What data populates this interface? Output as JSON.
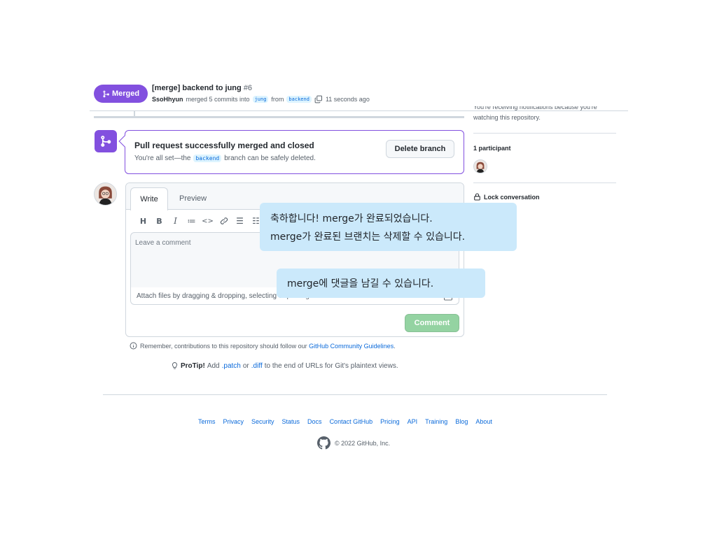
{
  "header": {
    "status_badge": "Merged",
    "pr_title": "[merge] backend to jung",
    "pr_number": "#6",
    "author": "SsoHhyun",
    "merge_text": "merged 5 commits into",
    "base_branch": "jung",
    "from_text": "from",
    "head_branch": "backend",
    "time_ago": "11 seconds ago"
  },
  "sidebar": {
    "notification_line1": "You're receiving notifications because you're",
    "notification_line2": "watching this repository.",
    "participants_title": "1 participant",
    "lock_label": "Lock conversation"
  },
  "merged_box": {
    "title": "Pull request successfully merged and closed",
    "sub_prefix": "You're all set—the",
    "branch": "backend",
    "sub_suffix": "branch can be safely deleted.",
    "delete_button": "Delete branch"
  },
  "comment": {
    "tab_write": "Write",
    "tab_preview": "Preview",
    "toolbar": [
      "H",
      "B",
      "I",
      "≔",
      "<>",
      "🔗",
      "☰",
      "☷"
    ],
    "placeholder": "Leave a comment",
    "attach_text": "Attach files by dragging & dropping, selecting or pasting them.",
    "submit_button": "Comment"
  },
  "remember": {
    "text": "Remember, contributions to this repository should follow our",
    "link": "GitHub Community Guidelines",
    "end": "."
  },
  "protip": {
    "label": "ProTip!",
    "text1": "Add",
    "patch": ".patch",
    "or": "or",
    "diff": ".diff",
    "text2": "to the end of URLs for Git's plaintext views."
  },
  "callouts": {
    "first_line1": "축하합니다! merge가 완료되었습니다.",
    "first_line2": "merge가 완료된 브랜치는 삭제할 수 있습니다.",
    "second": "merge에 댓글을 남길 수 있습니다."
  },
  "footer": {
    "links": [
      "Terms",
      "Privacy",
      "Security",
      "Status",
      "Docs",
      "Contact GitHub",
      "Pricing",
      "API",
      "Training",
      "Blog",
      "About"
    ],
    "copyright": "© 2022 GitHub, Inc."
  },
  "colors": {
    "merged_purple": "#8250df",
    "link_blue": "#0969da",
    "comment_button_disabled": "#94d3a2",
    "callout_bg": "#cbe9fb"
  },
  "icons": {
    "merge": "git-merge-icon",
    "copy": "copy-icon",
    "lock": "lock-icon",
    "info": "info-icon",
    "bulb": "light-bulb-icon",
    "github": "github-mark-icon"
  }
}
